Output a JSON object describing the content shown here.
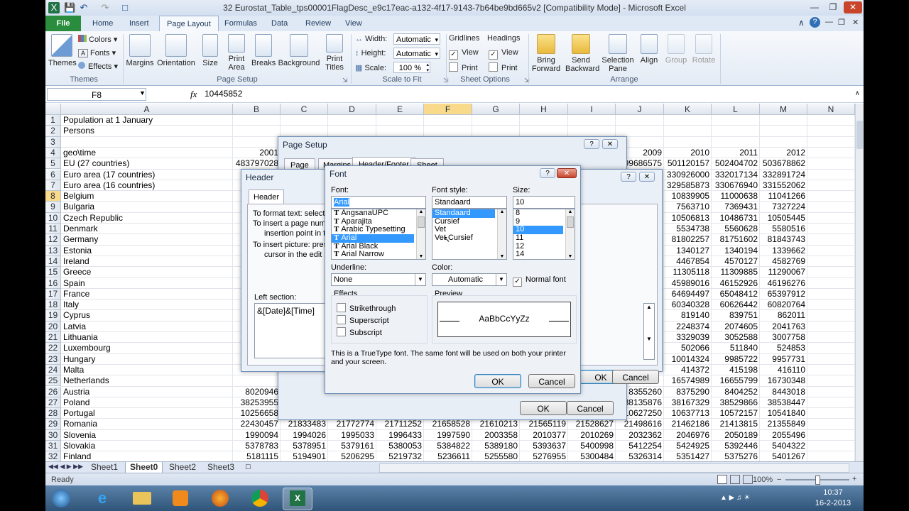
{
  "window": {
    "title": "32 Eurostat_Table_tps00001FlagDesc_e9c17eac-a132-4f17-9143-7b64be9bd665v2  [Compatibility Mode] - Microsoft Excel"
  },
  "tabs": [
    "File",
    "Home",
    "Insert",
    "Page Layout",
    "Formulas",
    "Data",
    "Review",
    "View"
  ],
  "active_tab": "Page Layout",
  "ribbon": {
    "themes": {
      "themes": "Themes",
      "colors": "Colors",
      "fonts": "Fonts",
      "effects": "Effects",
      "group": "Themes"
    },
    "page_setup": {
      "margins": "Margins",
      "orientation": "Orientation",
      "size": "Size",
      "print_area_1": "Print",
      "print_area_2": "Area",
      "breaks": "Breaks",
      "background": "Background",
      "print_titles_1": "Print",
      "print_titles_2": "Titles",
      "group": "Page Setup"
    },
    "scale": {
      "width_label": "Width:",
      "width_value": "Automatic",
      "height_label": "Height:",
      "height_value": "Automatic",
      "scale_label": "Scale:",
      "scale_value": "100 %",
      "group": "Scale to Fit"
    },
    "sheet_options": {
      "gridlines": "Gridlines",
      "headings": "Headings",
      "view": "View",
      "print": "Print",
      "group": "Sheet Options"
    },
    "arrange": {
      "bring_1": "Bring",
      "bring_2": "Forward",
      "send_1": "Send",
      "send_2": "Backward",
      "sel_1": "Selection",
      "sel_2": "Pane",
      "align": "Align",
      "group_btn": "Group",
      "rotate": "Rotate",
      "group": "Arrange"
    }
  },
  "formula_bar": {
    "name_box": "F8",
    "fx": "fx",
    "value": "10445852"
  },
  "columns": [
    "A",
    "B",
    "C",
    "D",
    "E",
    "F",
    "G",
    "H",
    "I",
    "J",
    "K",
    "L",
    "M",
    "N"
  ],
  "rows": [
    {
      "n": "1",
      "a": "Population at 1 January",
      "b": "",
      "j": "",
      "k": "",
      "l": "",
      "m": ""
    },
    {
      "n": "2",
      "a": "Persons",
      "b": "",
      "j": "",
      "k": "",
      "l": "",
      "m": ""
    },
    {
      "n": "3",
      "a": "",
      "b": "",
      "j": "",
      "k": "",
      "l": "",
      "m": ""
    },
    {
      "n": "4",
      "a": "geo\\time",
      "b": "2001",
      "j": "2009",
      "k": "2010",
      "l": "2011",
      "m": "2012"
    },
    {
      "n": "5",
      "a": "EU (27 countries)",
      "b": "483797028",
      "j": "99686575",
      "k": "501120157",
      "l": "502404702",
      "m": "503678862"
    },
    {
      "n": "6",
      "a": "Euro area (17 countries)",
      "b": "3",
      "j": "",
      "k": "330926000",
      "l": "332017134",
      "m": "332891724"
    },
    {
      "n": "7",
      "a": "Euro area (16 countries)",
      "b": "",
      "j": "",
      "k": "329585873",
      "l": "330676940",
      "m": "331552062"
    },
    {
      "n": "8",
      "a": "Belgium",
      "b": "",
      "j": "",
      "k": "10839905",
      "l": "11000638",
      "m": "11041266"
    },
    {
      "n": "9",
      "a": "Bulgaria",
      "b": "",
      "j": "",
      "k": "7563710",
      "l": "7369431",
      "m": "7327224"
    },
    {
      "n": "10",
      "a": "Czech Republic",
      "b": "",
      "j": "",
      "k": "10506813",
      "l": "10486731",
      "m": "10505445"
    },
    {
      "n": "11",
      "a": "Denmark",
      "b": "",
      "j": "",
      "k": "5534738",
      "l": "5560628",
      "m": "5580516"
    },
    {
      "n": "12",
      "a": "Germany",
      "b": "",
      "j": "",
      "k": "81802257",
      "l": "81751602",
      "m": "81843743"
    },
    {
      "n": "13",
      "a": "Estonia",
      "b": "",
      "j": "",
      "k": "1340127",
      "l": "1340194",
      "m": "1339662"
    },
    {
      "n": "14",
      "a": "Ireland",
      "b": "",
      "j": "",
      "k": "4467854",
      "l": "4570127",
      "m": "4582769"
    },
    {
      "n": "15",
      "a": "Greece",
      "b": "",
      "j": "",
      "k": "11305118",
      "l": "11309885",
      "m": "11290067"
    },
    {
      "n": "16",
      "a": "Spain",
      "b": "",
      "j": "",
      "k": "45989016",
      "l": "46152926",
      "m": "46196276"
    },
    {
      "n": "17",
      "a": "France",
      "b": "",
      "j": "",
      "k": "64694497",
      "l": "65048412",
      "m": "65397912"
    },
    {
      "n": "18",
      "a": "Italy",
      "b": "",
      "j": "",
      "k": "60340328",
      "l": "60626442",
      "m": "60820764"
    },
    {
      "n": "19",
      "a": "Cyprus",
      "b": "",
      "j": "",
      "k": "819140",
      "l": "839751",
      "m": "862011"
    },
    {
      "n": "20",
      "a": "Latvia",
      "b": "",
      "j": "",
      "k": "2248374",
      "l": "2074605",
      "m": "2041763"
    },
    {
      "n": "21",
      "a": "Lithuania",
      "b": "",
      "j": "",
      "k": "3329039",
      "l": "3052588",
      "m": "3007758"
    },
    {
      "n": "22",
      "a": "Luxembourg",
      "b": "",
      "j": "",
      "k": "502066",
      "l": "511840",
      "m": "524853"
    },
    {
      "n": "23",
      "a": "Hungary",
      "b": "",
      "j": "",
      "k": "10014324",
      "l": "9985722",
      "m": "9957731"
    },
    {
      "n": "24",
      "a": "Malta",
      "b": "",
      "j": "",
      "k": "414372",
      "l": "415198",
      "m": "416110"
    },
    {
      "n": "25",
      "a": "Netherlands",
      "b": "",
      "j": "",
      "k": "16574989",
      "l": "16655799",
      "m": "16730348"
    },
    {
      "n": "26",
      "a": "Austria",
      "b": "8020946",
      "j": "8355260",
      "k": "8375290",
      "l": "8404252",
      "m": "8443018"
    },
    {
      "n": "27",
      "a": "Poland",
      "b": "38253955",
      "j": "38135876",
      "k": "38167329",
      "l": "38529866",
      "m": "38538447"
    },
    {
      "n": "28",
      "a": "Portugal",
      "b": "10256658",
      "j": "10627250",
      "k": "10637713",
      "l": "10572157",
      "m": "10541840"
    }
  ],
  "full_rows": [
    {
      "n": "29",
      "a": "Romania",
      "v": [
        "22430457",
        "21833483",
        "21772774",
        "21711252",
        "21658528",
        "21610213",
        "21565119",
        "21528627",
        "21498616",
        "21462186",
        "21413815",
        "21355849"
      ]
    },
    {
      "n": "30",
      "a": "Slovenia",
      "v": [
        "1990094",
        "1994026",
        "1995033",
        "1996433",
        "1997590",
        "2003358",
        "2010377",
        "2010269",
        "2032362",
        "2046976",
        "2050189",
        "2055496"
      ]
    },
    {
      "n": "31",
      "a": "Slovakia",
      "v": [
        "5378783",
        "5378951",
        "5379161",
        "5380053",
        "5384822",
        "5389180",
        "5393637",
        "5400998",
        "5412254",
        "5424925",
        "5392446",
        "5404322"
      ]
    },
    {
      "n": "32",
      "a": "Finland",
      "v": [
        "5181115",
        "5194901",
        "5206295",
        "5219732",
        "5236611",
        "5255580",
        "5276955",
        "5300484",
        "5326314",
        "5351427",
        "5375276",
        "5401267"
      ]
    }
  ],
  "sheets": [
    "Sheet1",
    "Sheet0",
    "Sheet2",
    "Sheet3"
  ],
  "active_sheet": "Sheet0",
  "status": {
    "ready": "Ready",
    "zoom": "100%"
  },
  "clock": {
    "time": "10:37",
    "date": "16-2-2013"
  },
  "page_setup_dialog": {
    "title": "Page Setup",
    "tabs": [
      "Page",
      "Margins",
      "Header/Footer",
      "Sheet"
    ],
    "ok": "OK",
    "cancel": "Cancel"
  },
  "header_dialog": {
    "title": "Header",
    "tab": "Header",
    "line1": "To format text:  select t",
    "line2": "To insert a page numbe",
    "line3": "insertion point in the",
    "line4": "To insert picture: press",
    "line5": "cursor in the edit bo",
    "left_section_label": "Left section:",
    "left_section_value": "&[Date]&[Time]",
    "ok": "OK",
    "cancel": "Cancel"
  },
  "font_dialog": {
    "title": "Font",
    "font_label": "Font:",
    "font_value": "Arial",
    "fonts": [
      "AngsanaUPC",
      "Aparajita",
      "Arabic Typesetting",
      "Arial",
      "Arial Black",
      "Arial Narrow"
    ],
    "selected_font": "Arial",
    "style_label": "Font style:",
    "style_value": "Standaard",
    "styles": [
      "Standaard",
      "Cursief",
      "Vet",
      "Vet Cursief"
    ],
    "size_label": "Size:",
    "size_value": "10",
    "sizes": [
      "8",
      "9",
      "10",
      "11",
      "12",
      "14"
    ],
    "underline_label": "Underline:",
    "underline_value": "None",
    "color_label": "Color:",
    "color_value": "Automatic",
    "normal_font": "Normal font",
    "effects_label": "Effects",
    "effects": [
      "Strikethrough",
      "Superscript",
      "Subscript"
    ],
    "preview_label": "Preview",
    "preview_text": "AaBbCcYyZz",
    "info": "This is a TrueType font.  The same font will be used on both your printer and your screen.",
    "ok": "OK",
    "cancel": "Cancel"
  },
  "colors": {
    "accent": "#2a8d3e",
    "selection": "#3399ff",
    "header_sel": "#f9d98a"
  }
}
